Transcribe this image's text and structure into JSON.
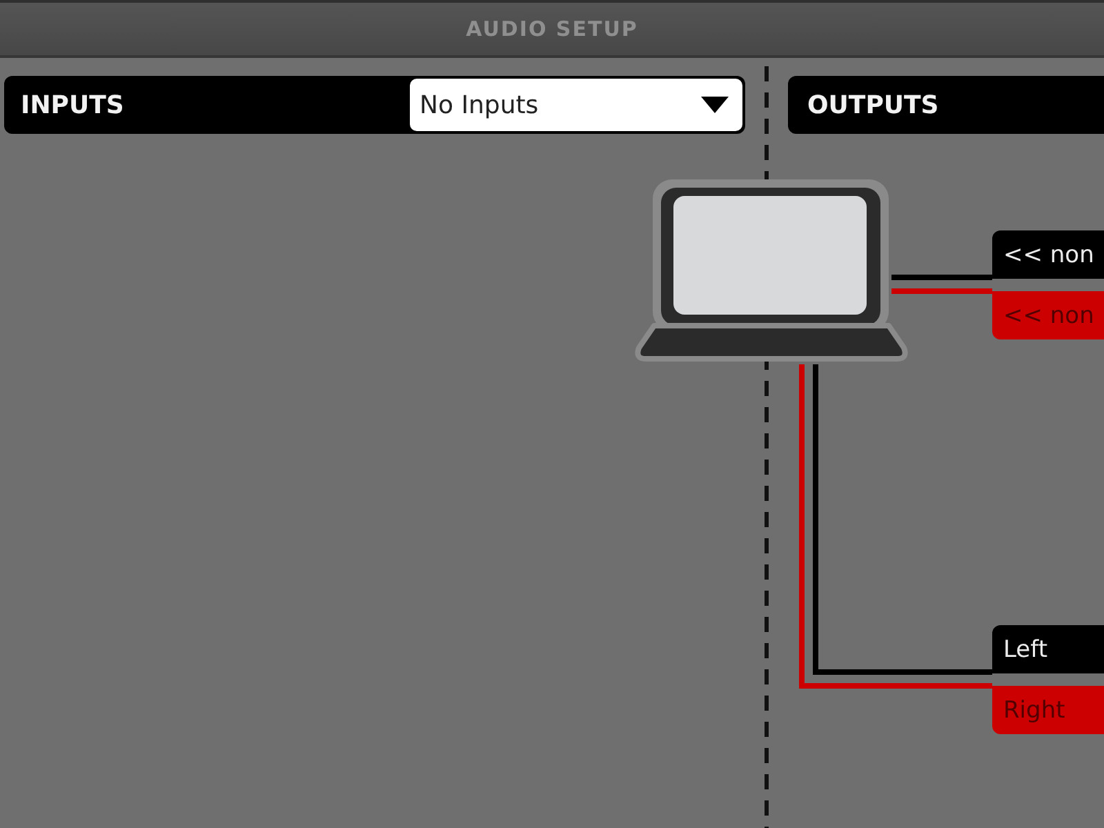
{
  "window": {
    "title": "AUDIO SETUP"
  },
  "inputs": {
    "label": "INPUTS",
    "dropdown": {
      "value": "No Inputs"
    }
  },
  "outputs": {
    "label": "OUTPUTS"
  },
  "connections": [
    {
      "kind": "side",
      "channels": [
        {
          "label": "<< non",
          "color": "#000000"
        },
        {
          "label": "<< non",
          "color": "#cc0000"
        }
      ]
    },
    {
      "kind": "bottom",
      "channels": [
        {
          "label": "Left",
          "color": "#000000"
        },
        {
          "label": "Right",
          "color": "#cc0000"
        }
      ]
    }
  ]
}
